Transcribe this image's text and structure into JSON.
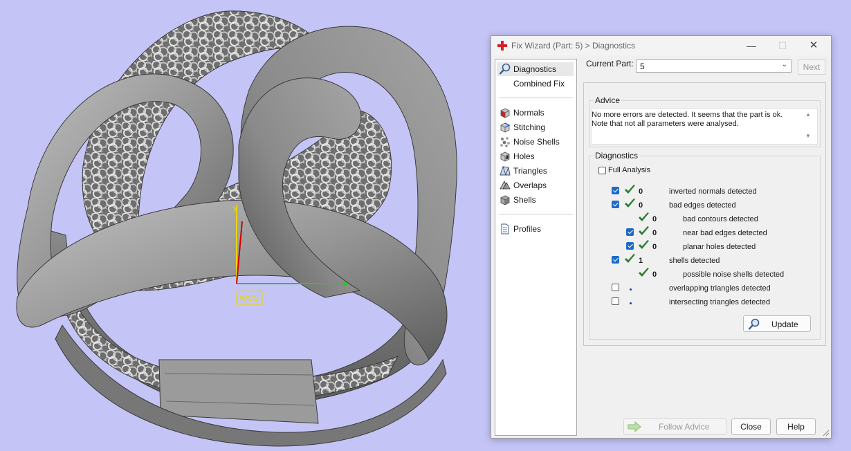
{
  "viewport": {
    "wcs_label": "WCS",
    "axis_y_label": "y",
    "colors": {
      "background": "#c4c4f6",
      "model": "#8e8e8e",
      "x_axis": "#22cc22",
      "y_axis": "#e8d600",
      "z_axis": "#cc0000"
    }
  },
  "dialog": {
    "title": "Fix Wizard (Part: 5) > Diagnostics",
    "sidebar": {
      "items": [
        {
          "label": "Diagnostics",
          "icon": "magnifier-icon",
          "active": true
        },
        {
          "label": "Combined Fix",
          "icon": "blank-icon"
        },
        {
          "label": "Normals",
          "icon": "normals-cube-icon"
        },
        {
          "label": "Stitching",
          "icon": "stitching-icon"
        },
        {
          "label": "Noise Shells",
          "icon": "noise-shells-icon"
        },
        {
          "label": "Holes",
          "icon": "holes-cube-icon"
        },
        {
          "label": "Triangles",
          "icon": "triangles-icon"
        },
        {
          "label": "Overlaps",
          "icon": "overlaps-icon"
        },
        {
          "label": "Shells",
          "icon": "shells-cube-icon"
        },
        {
          "label": "Profiles",
          "icon": "document-icon"
        }
      ]
    },
    "current_part_label": "Current Part:",
    "current_part_value": "5",
    "next_label": "Next",
    "advice": {
      "legend": "Advice",
      "text": "No more errors are detected. It seems that the part is ok.\nNote that not all parameters were analysed."
    },
    "diagnostics": {
      "legend": "Diagnostics",
      "full_analysis_label": "Full Analysis",
      "full_analysis_checked": false,
      "rows": [
        {
          "checkbox": true,
          "checked": true,
          "ok": true,
          "count": "0",
          "label": "inverted normals detected",
          "indent": 0
        },
        {
          "checkbox": true,
          "checked": true,
          "ok": true,
          "count": "0",
          "label": "bad edges detected",
          "indent": 0
        },
        {
          "checkbox": false,
          "checked": false,
          "ok": true,
          "count": "0",
          "label": "bad contours detected",
          "indent": 1
        },
        {
          "checkbox": true,
          "checked": true,
          "ok": true,
          "count": "0",
          "label": "near bad edges detected",
          "indent": 1
        },
        {
          "checkbox": true,
          "checked": true,
          "ok": true,
          "count": "0",
          "label": "planar holes detected",
          "indent": 1
        },
        {
          "checkbox": true,
          "checked": true,
          "ok": true,
          "count": "1",
          "label": "shells detected",
          "indent": 0
        },
        {
          "checkbox": false,
          "checked": false,
          "ok": true,
          "count": "0",
          "label": "possible noise shells detected",
          "indent": 1
        },
        {
          "checkbox": true,
          "checked": false,
          "ok": false,
          "count": "",
          "label": "overlapping triangles detected",
          "indent": 0
        },
        {
          "checkbox": true,
          "checked": false,
          "ok": false,
          "count": "",
          "label": "intersecting triangles detected",
          "indent": 0
        }
      ],
      "update_label": "Update"
    },
    "buttons": {
      "follow_advice": "Follow Advice",
      "close": "Close",
      "help": "Help"
    }
  }
}
